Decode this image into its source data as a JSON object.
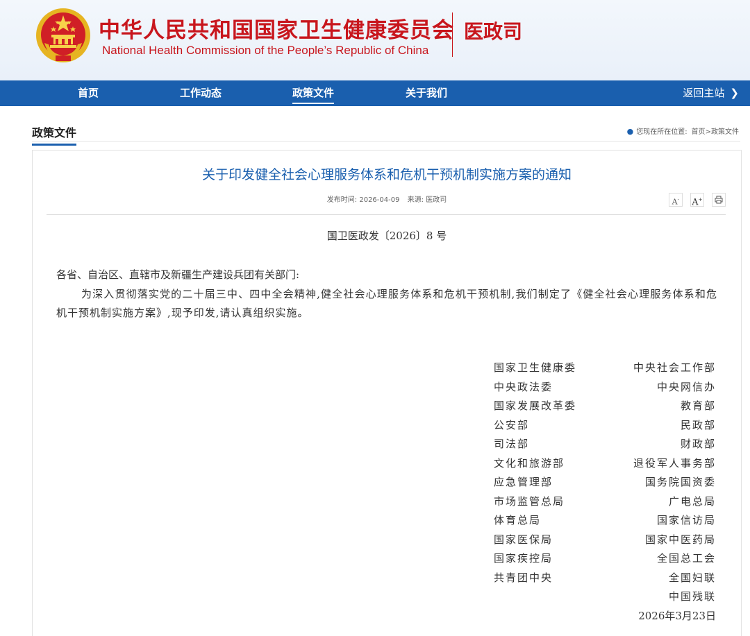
{
  "header": {
    "title": "中华人民共和国国家卫生健康委员会",
    "subtitle": "National Health Commission of the People’s Republic of China",
    "department": "医政司",
    "emblem_icon": "national-emblem-icon"
  },
  "nav": {
    "items": [
      {
        "label": "首页"
      },
      {
        "label": "工作动态"
      },
      {
        "label": "政策文件",
        "active": true
      },
      {
        "label": "关于我们"
      }
    ],
    "back_label": "返回主站",
    "back_icon": "chevron-right-icon"
  },
  "section": {
    "title": "政策文件",
    "location_label": "您现在所在位置:",
    "breadcrumb": "首页>政策文件",
    "location_icon": "map-pin-icon"
  },
  "article": {
    "title": "关于印发健全社会心理服务体系和危机干预机制实施方案的通知",
    "publish_label": "发布时间:",
    "publish_date": "2026-04-09",
    "source_label": "来源:",
    "source": "医政司",
    "tools": {
      "font_smaller": "A",
      "font_larger": "A",
      "print_icon": "printer-icon"
    },
    "doc_number": "国卫医政发〔2026〕8 号",
    "salutation": "各省、自治区、直辖市及新疆生产建设兵团有关部门:",
    "body": "为深入贯彻落实党的二十届三中、四中全会精神,健全社会心理服务体系和危机干预机制,我们制定了《健全社会心理服务体系和危机干预机制实施方案》,现予印发,请认真组织实施。",
    "signatories": [
      {
        "left": "国家卫生健康委",
        "right": "中央社会工作部"
      },
      {
        "left": "中央政法委",
        "right": "中央网信办"
      },
      {
        "left": "国家发展改革委",
        "right": "教育部"
      },
      {
        "left": "公安部",
        "right": "民政部"
      },
      {
        "left": "司法部",
        "right": "财政部"
      },
      {
        "left": "文化和旅游部",
        "right": "退役军人事务部"
      },
      {
        "left": "应急管理部",
        "right": "国务院国资委"
      },
      {
        "left": "市场监管总局",
        "right": "广电总局"
      },
      {
        "left": "体育总局",
        "right": "国家信访局"
      },
      {
        "left": "国家医保局",
        "right": "国家中医药局"
      },
      {
        "left": "国家疾控局",
        "right": "全国总工会"
      },
      {
        "left": "共青团中央",
        "right": "全国妇联"
      },
      {
        "left": "",
        "right": "中国残联"
      }
    ],
    "date": "2026年3月23日"
  },
  "colors": {
    "brand_red": "#c8161d",
    "nav_blue": "#1a5fae",
    "title_blue": "#1a5fae"
  }
}
